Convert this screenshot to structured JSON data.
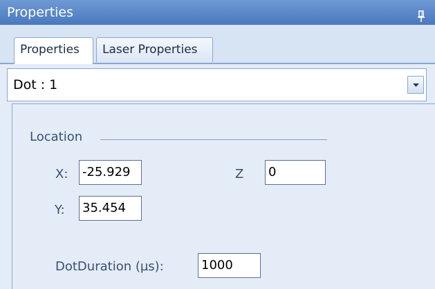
{
  "titlebar": {
    "title": "Properties",
    "pin_icon": "pin-icon"
  },
  "tabs": [
    {
      "label": "Properties",
      "active": true
    },
    {
      "label": "Laser Properties",
      "active": false
    }
  ],
  "object_selector": {
    "value": "Dot  :  1",
    "dropdown_icon": "chevron-down-icon"
  },
  "location": {
    "group_label": "Location",
    "x_label": "X:",
    "x_value": "-25.929",
    "y_label": "Y:",
    "y_value": "35.454",
    "z_label": "Z",
    "z_value": "0"
  },
  "dot_duration": {
    "label": "DotDuration (µs):",
    "value": "1000"
  },
  "colors": {
    "title_bar": "#5a87c8",
    "panel_background": "#e4ecf7",
    "label_text": "#3a4f73"
  }
}
